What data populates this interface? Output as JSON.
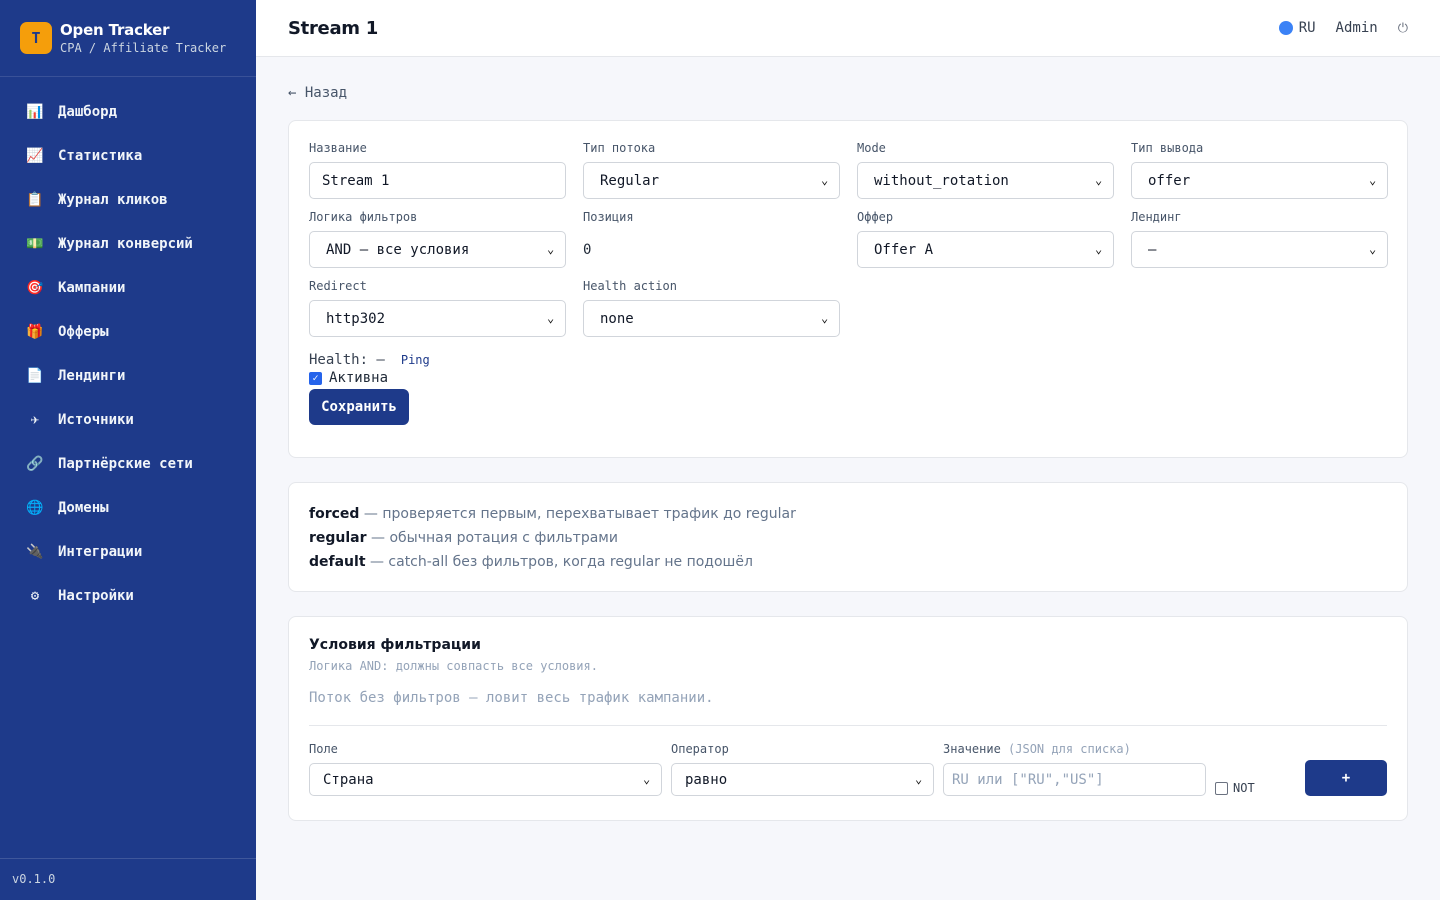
{
  "brand": {
    "logo_letter": "T",
    "name": "Open Tracker",
    "subtitle": "CPA / Affiliate Tracker"
  },
  "nav": [
    {
      "label": "Дашборд",
      "icon": "📊"
    },
    {
      "label": "Статистика",
      "icon": "📈"
    },
    {
      "label": "Журнал кликов",
      "icon": "📋"
    },
    {
      "label": "Журнал конверсий",
      "icon": "💵"
    },
    {
      "label": "Кампании",
      "icon": "🎯"
    },
    {
      "label": "Офферы",
      "icon": "🎁"
    },
    {
      "label": "Лендинги",
      "icon": "📄"
    },
    {
      "label": "Источники",
      "icon": "✈"
    },
    {
      "label": "Партнёрские сети",
      "icon": "🔗"
    },
    {
      "label": "Домены",
      "icon": "🌐"
    },
    {
      "label": "Интеграции",
      "icon": "🔌"
    },
    {
      "label": "Настройки",
      "icon": "⚙"
    }
  ],
  "version": "v0.1.0",
  "header": {
    "title": "Stream 1",
    "lang": "RU",
    "user": "Admin",
    "power_icon": "⏻"
  },
  "back_label": "← Назад",
  "form": {
    "name_label": "Название",
    "name_value": "Stream 1",
    "type_label": "Тип потока",
    "type_value": "Regular",
    "mode_label": "Mode",
    "mode_value": "without_rotation",
    "output_label": "Тип вывода",
    "output_value": "offer",
    "logic_label": "Логика фильтров",
    "logic_value": "AND — все условия",
    "position_label": "Позиция",
    "position_value": "0",
    "offer_label": "Оффер",
    "offer_value": "Offer A",
    "landing_label": "Лендинг",
    "landing_value": "—",
    "redirect_label": "Redirect",
    "redirect_value": "http302",
    "health_action_label": "Health action",
    "health_action_value": "none",
    "health_text": "Health: —",
    "ping_label": "Ping",
    "active_label": "Активна",
    "active_checked": true,
    "save_label": "Сохранить"
  },
  "info": [
    {
      "term": "forced",
      "desc": " — проверяется первым, перехватывает трафик до regular"
    },
    {
      "term": "regular",
      "desc": " — обычная ротация с фильтрами"
    },
    {
      "term": "default",
      "desc": " — catch-all без фильтров, когда regular не подошёл"
    }
  ],
  "filters": {
    "title": "Условия фильтрации",
    "subtitle": "Логика AND: должны совпасть все условия.",
    "empty": "Поток без фильтров — ловит весь трафик кампании.",
    "field_label": "Поле",
    "field_value": "Страна",
    "operator_label": "Оператор",
    "operator_value": "равно",
    "value_label": "Значение",
    "value_hint": "(JSON для списка)",
    "value_placeholder": "RU  или  [\"RU\",\"US\"]",
    "not_label": "NOT",
    "add_label": "+"
  },
  "colors": {
    "sidebar": "#1e3a8a",
    "accent": "#1e3a8a",
    "logo": "#f59e0b"
  }
}
